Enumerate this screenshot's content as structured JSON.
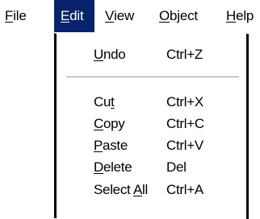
{
  "menubar": {
    "items": [
      {
        "pre": "",
        "mnemonic": "F",
        "post": "ile"
      },
      {
        "pre": "",
        "mnemonic": "E",
        "post": "dit"
      },
      {
        "pre": "",
        "mnemonic": "V",
        "post": "iew"
      },
      {
        "pre": "",
        "mnemonic": "O",
        "post": "bject"
      },
      {
        "pre": "",
        "mnemonic": "H",
        "post": "elp"
      }
    ],
    "active_index": 1
  },
  "edit_menu": {
    "items": [
      {
        "pre": "",
        "mnemonic": "U",
        "post": "ndo",
        "shortcut": "Ctrl+Z"
      },
      {
        "pre": "Cu",
        "mnemonic": "t",
        "post": "",
        "shortcut": "Ctrl+X"
      },
      {
        "pre": "",
        "mnemonic": "C",
        "post": "opy",
        "shortcut": "Ctrl+C"
      },
      {
        "pre": "",
        "mnemonic": "P",
        "post": "aste",
        "shortcut": "Ctrl+V"
      },
      {
        "pre": "",
        "mnemonic": "D",
        "post": "elete",
        "shortcut": "Del"
      },
      {
        "pre": "Select ",
        "mnemonic": "A",
        "post": "ll",
        "shortcut": "Ctrl+A"
      }
    ]
  },
  "colors": {
    "highlight": "#08236b",
    "menu_background": "#ffffff",
    "separator": "#9c9c9c"
  }
}
